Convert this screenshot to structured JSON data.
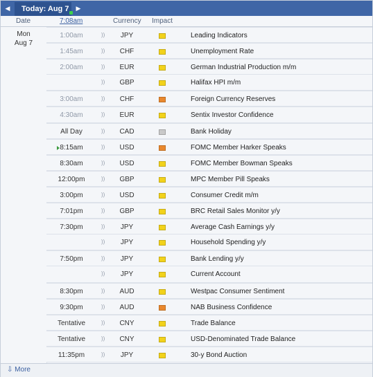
{
  "toolbar": {
    "today_label": "Today: Aug 7"
  },
  "headers": {
    "date": "Date",
    "time": "7:08am",
    "currency": "Currency",
    "impact": "Impact"
  },
  "day": {
    "weekday": "Mon",
    "date": "Aug 7"
  },
  "colors": {
    "yellow": "#f2d21b",
    "orange": "#e9882e",
    "gray": "#c9c9c9",
    "accent": "#3f66a6"
  },
  "events": [
    {
      "time": "1:00am",
      "past": true,
      "currency": "JPY",
      "impact": "yellow",
      "title": "Leading Indicators",
      "group_start": true
    },
    {
      "time": "1:45am",
      "past": true,
      "currency": "CHF",
      "impact": "yellow",
      "title": "Unemployment Rate",
      "group_start": true
    },
    {
      "time": "2:00am",
      "past": true,
      "currency": "EUR",
      "impact": "yellow",
      "title": "German Industrial Production m/m",
      "group_start": true
    },
    {
      "time": "",
      "past": true,
      "currency": "GBP",
      "impact": "yellow",
      "title": "Halifax HPI m/m",
      "group_start": false
    },
    {
      "time": "3:00am",
      "past": true,
      "currency": "CHF",
      "impact": "orange",
      "title": "Foreign Currency Reserves",
      "group_start": true
    },
    {
      "time": "4:30am",
      "past": true,
      "currency": "EUR",
      "impact": "yellow",
      "title": "Sentix Investor Confidence",
      "group_start": true
    },
    {
      "time": "All Day",
      "past": false,
      "currency": "CAD",
      "impact": "gray",
      "title": "Bank Holiday",
      "group_start": true
    },
    {
      "time": "8:15am",
      "past": false,
      "next": true,
      "currency": "USD",
      "impact": "orange",
      "title": "FOMC Member Harker Speaks",
      "group_start": true
    },
    {
      "time": "8:30am",
      "past": false,
      "currency": "USD",
      "impact": "yellow",
      "title": "FOMC Member Bowman Speaks",
      "group_start": true
    },
    {
      "time": "12:00pm",
      "past": false,
      "currency": "GBP",
      "impact": "yellow",
      "title": "MPC Member Pill Speaks",
      "group_start": true
    },
    {
      "time": "3:00pm",
      "past": false,
      "currency": "USD",
      "impact": "yellow",
      "title": "Consumer Credit m/m",
      "group_start": true
    },
    {
      "time": "7:01pm",
      "past": false,
      "currency": "GBP",
      "impact": "yellow",
      "title": "BRC Retail Sales Monitor y/y",
      "group_start": true
    },
    {
      "time": "7:30pm",
      "past": false,
      "currency": "JPY",
      "impact": "yellow",
      "title": "Average Cash Earnings y/y",
      "group_start": true
    },
    {
      "time": "",
      "past": false,
      "currency": "JPY",
      "impact": "yellow",
      "title": "Household Spending y/y",
      "group_start": false
    },
    {
      "time": "7:50pm",
      "past": false,
      "currency": "JPY",
      "impact": "yellow",
      "title": "Bank Lending y/y",
      "group_start": true
    },
    {
      "time": "",
      "past": false,
      "currency": "JPY",
      "impact": "yellow",
      "title": "Current Account",
      "group_start": false
    },
    {
      "time": "8:30pm",
      "past": false,
      "currency": "AUD",
      "impact": "yellow",
      "title": "Westpac Consumer Sentiment",
      "group_start": true
    },
    {
      "time": "9:30pm",
      "past": false,
      "currency": "AUD",
      "impact": "orange",
      "title": "NAB Business Confidence",
      "group_start": true
    },
    {
      "time": "Tentative",
      "past": false,
      "currency": "CNY",
      "impact": "yellow",
      "title": "Trade Balance",
      "group_start": true
    },
    {
      "time": "Tentative",
      "past": false,
      "currency": "CNY",
      "impact": "yellow",
      "title": "USD-Denominated Trade Balance",
      "group_start": true
    },
    {
      "time": "11:35pm",
      "past": false,
      "currency": "JPY",
      "impact": "yellow",
      "title": "30-y Bond Auction",
      "group_start": true
    }
  ],
  "footer": {
    "more_label": "More"
  }
}
